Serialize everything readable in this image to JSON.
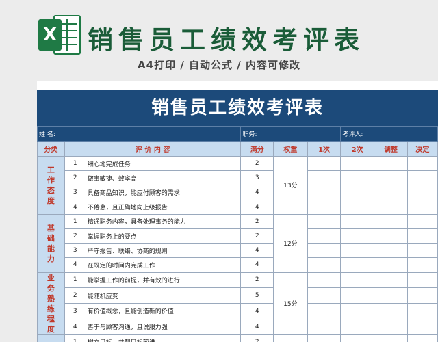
{
  "banner": {
    "logo_letter": "X",
    "title": "销售员工绩效考评表",
    "subtitle": "A4打印 / 自动公式 / 内容可修改"
  },
  "sheet": {
    "title": "销售员工绩效考评表",
    "info": {
      "name": "姓 名:",
      "position": "职务:",
      "evaluator": "考评人:"
    },
    "headers": [
      "分类",
      "评 价 内 容",
      "满分",
      "权重",
      "1次",
      "2次",
      "调整",
      "决定"
    ],
    "groups": [
      {
        "category": "工作态度",
        "weight": "13分",
        "rows": [
          {
            "no": "1",
            "content": "细心地完成任务",
            "score": "2"
          },
          {
            "no": "2",
            "content": "做事敏捷、效率高",
            "score": "3"
          },
          {
            "no": "3",
            "content": "具备商品知识，能应付顾客的需求",
            "score": "4"
          },
          {
            "no": "4",
            "content": "不倦怠，且正确地向上级报告",
            "score": "4"
          }
        ]
      },
      {
        "category": "基础能力",
        "weight": "12分",
        "rows": [
          {
            "no": "1",
            "content": "精通职务内容，具备处理事务的能力",
            "score": "2"
          },
          {
            "no": "2",
            "content": "掌握职务上的要点",
            "score": "2"
          },
          {
            "no": "3",
            "content": "严守报告、联络、协商的规则",
            "score": "4"
          },
          {
            "no": "4",
            "content": "在既定的时间内完成工作",
            "score": "4"
          }
        ]
      },
      {
        "category": "业务熟练程度",
        "weight": "15分",
        "rows": [
          {
            "no": "1",
            "content": "能掌握工作的前提，并有效的进行",
            "score": "2"
          },
          {
            "no": "2",
            "content": "能随机应变",
            "score": "5"
          },
          {
            "no": "3",
            "content": "有价值概念，且能创造新的价值",
            "score": "4"
          },
          {
            "no": "4",
            "content": "善于与顾客沟通，且说服力强",
            "score": "4"
          }
        ]
      },
      {
        "category": "",
        "weight": "",
        "rows": [
          {
            "no": "1",
            "content": "树立目标，并朝目标前进",
            "score": "2"
          }
        ]
      }
    ]
  }
}
